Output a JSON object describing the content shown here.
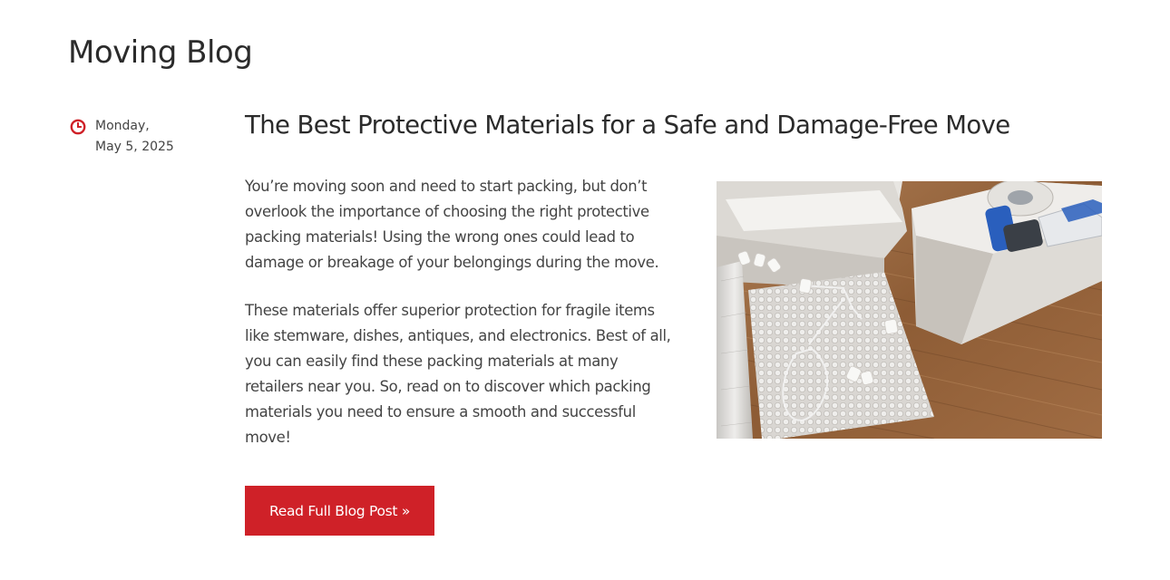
{
  "page": {
    "title": "Moving Blog"
  },
  "post": {
    "date_day": "Monday,",
    "date_full": "May 5, 2025",
    "date_icon": "clock-icon",
    "title": "The Best Protective Materials for a Safe and Damage-Free Move",
    "paragraphs": [
      "You’re moving soon and need to start packing, but don’t overlook the importance of choosing the right protective packing materials! Using the wrong ones could lead to damage or breakage of your belongings during the move.",
      "These materials offer superior protection for fragile items like stemware, dishes, antiques, and electronics. Best of all, you can easily find these packing materials at many retailers near you. So, read on to discover which packing materials you need to ensure a smooth and successful move!"
    ],
    "button_label": "Read Full Blog Post »",
    "image_subject": "packing-supplies-photo"
  },
  "colors": {
    "accent": "#cf2128",
    "text": "#444444",
    "heading": "#2b2b2b",
    "background": "#ffffff"
  }
}
